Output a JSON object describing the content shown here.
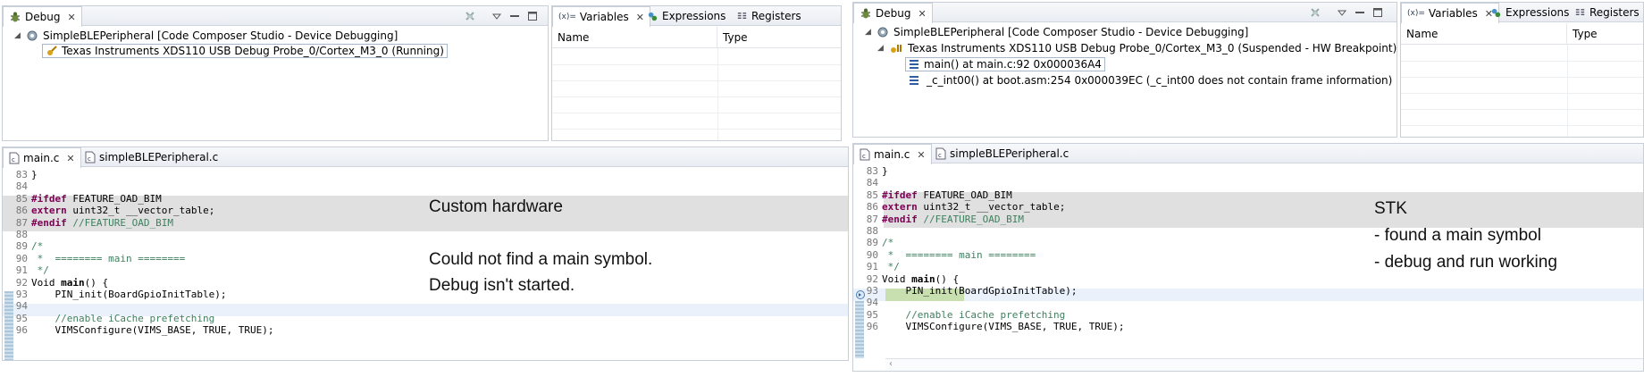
{
  "left": {
    "debug_view": {
      "tab_label": "Debug",
      "tree": {
        "project": "SimpleBLEPeripheral [Code Composer Studio - Device Debugging]",
        "probe": "Texas Instruments XDS110 USB Debug Probe_0/Cortex_M3_0 (Running)"
      }
    },
    "vars_view": {
      "tabs": [
        "Variables",
        "Expressions",
        "Registers"
      ],
      "tab_prefix": "(x)=",
      "columns": [
        "Name",
        "Type"
      ]
    },
    "editor": {
      "tabs": [
        "main.c",
        "simpleBLEPeripheral.c"
      ],
      "lines": [
        {
          "n": "83",
          "t": "}"
        },
        {
          "n": "84",
          "t": ""
        },
        {
          "n": "85",
          "pp": "#ifdef",
          "t": " FEATURE_OAD_BIM"
        },
        {
          "n": "86",
          "kw": "extern",
          "t": " uint32_t __vector_table;"
        },
        {
          "n": "87",
          "pp": "#endif",
          "cm": " //FEATURE_OAD_BIM"
        },
        {
          "n": "88",
          "t": ""
        },
        {
          "n": "89",
          "cm": "/*"
        },
        {
          "n": "90",
          "cm": " *  ======== main ========"
        },
        {
          "n": "91",
          "cm": " */"
        },
        {
          "n": "92",
          "t": "Void ",
          "b": "main",
          "t2": "() {"
        },
        {
          "n": "93",
          "t": "    PIN_init(BoardGpioInitTable);"
        },
        {
          "n": "94",
          "t": ""
        },
        {
          "n": "95",
          "cm": "    //enable iCache prefetching"
        },
        {
          "n": "96",
          "t": "    VIMSConfigure(VIMS_BASE, TRUE, TRUE);"
        }
      ]
    },
    "annotation": {
      "title": "Custom hardware",
      "line1": "Could not find a main symbol.",
      "line2": "Debug isn't started."
    }
  },
  "right": {
    "debug_view": {
      "tab_label": "Debug",
      "tree": {
        "project": "SimpleBLEPeripheral [Code Composer Studio - Device Debugging]",
        "probe": "Texas Instruments XDS110 USB Debug Probe_0/Cortex_M3_0 (Suspended - HW Breakpoint)",
        "frame1": "main() at main.c:92 0x000036A4",
        "frame2": "_c_int00() at boot.asm:254 0x000039EC  (_c_int00 does not contain frame information)"
      }
    },
    "vars_view": {
      "tabs": [
        "Variables",
        "Expressions",
        "Registers"
      ],
      "tab_prefix": "(x)=",
      "columns": [
        "Name",
        "Type"
      ]
    },
    "editor": {
      "tabs": [
        "main.c",
        "simpleBLEPeripheral.c"
      ],
      "lines": [
        {
          "n": "83",
          "t": "}"
        },
        {
          "n": "84",
          "t": ""
        },
        {
          "n": "85",
          "pp": "#ifdef",
          "t": " FEATURE_OAD_BIM"
        },
        {
          "n": "86",
          "kw": "extern",
          "t": " uint32_t __vector_table;"
        },
        {
          "n": "87",
          "pp": "#endif",
          "cm": " //FEATURE_OAD_BIM"
        },
        {
          "n": "88",
          "t": ""
        },
        {
          "n": "89",
          "cm": "/*"
        },
        {
          "n": "90",
          "cm": " *  ======== main ========"
        },
        {
          "n": "91",
          "cm": " */"
        },
        {
          "n": "92",
          "t": "Void ",
          "b": "main",
          "t2": "() {"
        },
        {
          "n": "93",
          "t": "    PIN_init(BoardGpioInitTable);"
        },
        {
          "n": "94",
          "t": ""
        },
        {
          "n": "95",
          "cm": "    //enable iCache prefetching"
        },
        {
          "n": "96",
          "t": "    VIMSConfigure(VIMS_BASE, TRUE, TRUE);"
        }
      ]
    },
    "annotation": {
      "title": "STK",
      "line1": "- found a main symbol",
      "line2": "- debug and run working"
    }
  },
  "colors": {
    "tab_bg": "#e9edf3",
    "preproc_highlight": "#e0e0e0",
    "current_line": "#eaf1fb",
    "keyword": "#7f0055",
    "comment": "#3f7f5f",
    "ruler": "#a9c6db"
  }
}
